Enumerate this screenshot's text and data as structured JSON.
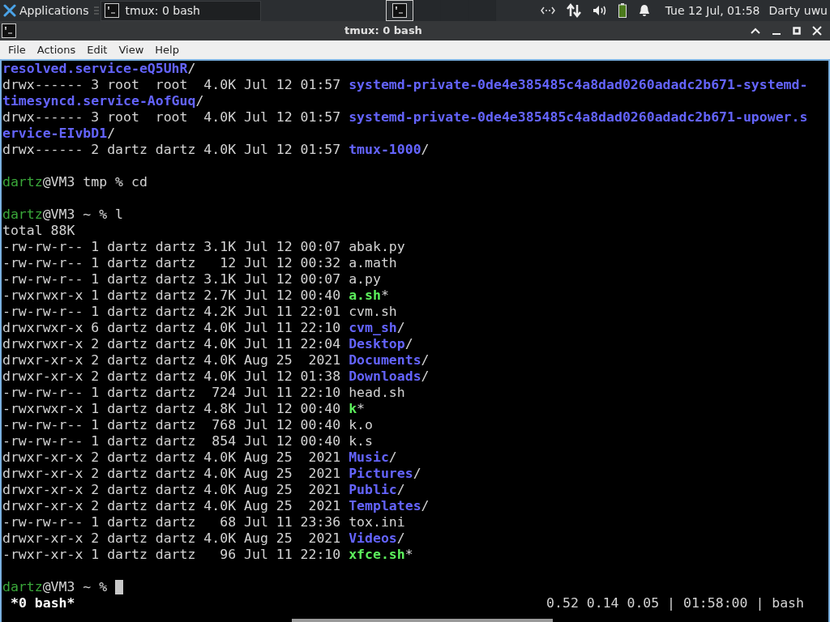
{
  "panel": {
    "applications": "Applications",
    "tasks": [
      {
        "label": "tmux: 0 bash",
        "selected": true
      }
    ],
    "workspaces": [
      {
        "selected": true
      },
      {
        "selected": false
      },
      {
        "selected": false
      },
      {
        "selected": false
      }
    ],
    "clock": "Tue 12 Jul, 01:58",
    "user": "Darty uwu"
  },
  "window": {
    "title": "tmux: 0 bash",
    "menu": [
      "File",
      "Actions",
      "Edit",
      "View",
      "Help"
    ]
  },
  "terminal": {
    "lines": [
      {
        "kind": "output",
        "segments": [
          {
            "kind": "dir",
            "text": "resolved.service-eQ5UhR"
          },
          {
            "kind": "plain",
            "text": "/"
          }
        ]
      },
      {
        "kind": "output",
        "segments": [
          {
            "kind": "plain",
            "text": "drwx------ 3 root  root  4.0K Jul 12 01:57 "
          },
          {
            "kind": "dir",
            "text": "systemd-private-0de4e385485c4a8dad0260adadc2b671-systemd-"
          }
        ]
      },
      {
        "kind": "output",
        "segments": [
          {
            "kind": "dir",
            "text": "timesyncd.service-AofGuq"
          },
          {
            "kind": "plain",
            "text": "/"
          }
        ]
      },
      {
        "kind": "output",
        "segments": [
          {
            "kind": "plain",
            "text": "drwx------ 3 root  root  4.0K Jul 12 01:57 "
          },
          {
            "kind": "dir",
            "text": "systemd-private-0de4e385485c4a8dad0260adadc2b671-upower.s"
          }
        ]
      },
      {
        "kind": "output",
        "segments": [
          {
            "kind": "dir",
            "text": "ervice-EIvbD1"
          },
          {
            "kind": "plain",
            "text": "/"
          }
        ]
      },
      {
        "kind": "output",
        "segments": [
          {
            "kind": "plain",
            "text": "drwx------ 2 dartz dartz 4.0K Jul 12 01:57 "
          },
          {
            "kind": "dir",
            "text": "tmux-1000"
          },
          {
            "kind": "plain",
            "text": "/"
          }
        ]
      },
      {
        "kind": "blank"
      },
      {
        "kind": "output",
        "segments": [
          {
            "kind": "user",
            "text": "dartz"
          },
          {
            "kind": "plain",
            "text": "@VM3 tmp % cd"
          }
        ]
      },
      {
        "kind": "blank"
      },
      {
        "kind": "output",
        "segments": [
          {
            "kind": "user",
            "text": "dartz"
          },
          {
            "kind": "plain",
            "text": "@VM3 ~ % l"
          }
        ]
      },
      {
        "kind": "output",
        "segments": [
          {
            "kind": "plain",
            "text": "total 88K"
          }
        ]
      },
      {
        "kind": "output",
        "segments": [
          {
            "kind": "plain",
            "text": "-rw-rw-r-- 1 dartz dartz 3.1K Jul 12 00:07 abak.py"
          }
        ]
      },
      {
        "kind": "output",
        "segments": [
          {
            "kind": "plain",
            "text": "-rw-rw-r-- 1 dartz dartz   12 Jul 12 00:32 a.math"
          }
        ]
      },
      {
        "kind": "output",
        "segments": [
          {
            "kind": "plain",
            "text": "-rw-rw-r-- 1 dartz dartz 3.1K Jul 12 00:07 a.py"
          }
        ]
      },
      {
        "kind": "output",
        "segments": [
          {
            "kind": "plain",
            "text": "-rwxrwxr-x 1 dartz dartz 2.7K Jul 12 00:40 "
          },
          {
            "kind": "exec",
            "text": "a.sh"
          },
          {
            "kind": "plain",
            "text": "*"
          }
        ]
      },
      {
        "kind": "output",
        "segments": [
          {
            "kind": "plain",
            "text": "-rw-rw-r-- 1 dartz dartz 4.2K Jul 11 22:01 cvm.sh"
          }
        ]
      },
      {
        "kind": "output",
        "segments": [
          {
            "kind": "plain",
            "text": "drwxrwxr-x 6 dartz dartz 4.0K Jul 11 22:10 "
          },
          {
            "kind": "dir",
            "text": "cvm_sh"
          },
          {
            "kind": "plain",
            "text": "/"
          }
        ]
      },
      {
        "kind": "output",
        "segments": [
          {
            "kind": "plain",
            "text": "drwxrwxr-x 2 dartz dartz 4.0K Jul 11 22:04 "
          },
          {
            "kind": "dir",
            "text": "Desktop"
          },
          {
            "kind": "plain",
            "text": "/"
          }
        ]
      },
      {
        "kind": "output",
        "segments": [
          {
            "kind": "plain",
            "text": "drwxr-xr-x 2 dartz dartz 4.0K Aug 25  2021 "
          },
          {
            "kind": "dir",
            "text": "Documents"
          },
          {
            "kind": "plain",
            "text": "/"
          }
        ]
      },
      {
        "kind": "output",
        "segments": [
          {
            "kind": "plain",
            "text": "drwxr-xr-x 2 dartz dartz 4.0K Jul 12 01:38 "
          },
          {
            "kind": "dir",
            "text": "Downloads"
          },
          {
            "kind": "plain",
            "text": "/"
          }
        ]
      },
      {
        "kind": "output",
        "segments": [
          {
            "kind": "plain",
            "text": "-rw-rw-r-- 1 dartz dartz  724 Jul 11 22:10 head.sh"
          }
        ]
      },
      {
        "kind": "output",
        "segments": [
          {
            "kind": "plain",
            "text": "-rwxrwxr-x 1 dartz dartz 4.8K Jul 12 00:40 "
          },
          {
            "kind": "exec",
            "text": "k"
          },
          {
            "kind": "plain",
            "text": "*"
          }
        ]
      },
      {
        "kind": "output",
        "segments": [
          {
            "kind": "plain",
            "text": "-rw-rw-r-- 1 dartz dartz  768 Jul 12 00:40 k.o"
          }
        ]
      },
      {
        "kind": "output",
        "segments": [
          {
            "kind": "plain",
            "text": "-rw-rw-r-- 1 dartz dartz  854 Jul 12 00:40 k.s"
          }
        ]
      },
      {
        "kind": "output",
        "segments": [
          {
            "kind": "plain",
            "text": "drwxr-xr-x 2 dartz dartz 4.0K Aug 25  2021 "
          },
          {
            "kind": "dir",
            "text": "Music"
          },
          {
            "kind": "plain",
            "text": "/"
          }
        ]
      },
      {
        "kind": "output",
        "segments": [
          {
            "kind": "plain",
            "text": "drwxr-xr-x 2 dartz dartz 4.0K Aug 25  2021 "
          },
          {
            "kind": "dir",
            "text": "Pictures"
          },
          {
            "kind": "plain",
            "text": "/"
          }
        ]
      },
      {
        "kind": "output",
        "segments": [
          {
            "kind": "plain",
            "text": "drwxr-xr-x 2 dartz dartz 4.0K Aug 25  2021 "
          },
          {
            "kind": "dir",
            "text": "Public"
          },
          {
            "kind": "plain",
            "text": "/"
          }
        ]
      },
      {
        "kind": "output",
        "segments": [
          {
            "kind": "plain",
            "text": "drwxr-xr-x 2 dartz dartz 4.0K Aug 25  2021 "
          },
          {
            "kind": "dir",
            "text": "Templates"
          },
          {
            "kind": "plain",
            "text": "/"
          }
        ]
      },
      {
        "kind": "output",
        "segments": [
          {
            "kind": "plain",
            "text": "-rw-rw-r-- 1 dartz dartz   68 Jul 11 23:36 tox.ini"
          }
        ]
      },
      {
        "kind": "output",
        "segments": [
          {
            "kind": "plain",
            "text": "drwxr-xr-x 2 dartz dartz 4.0K Aug 25  2021 "
          },
          {
            "kind": "dir",
            "text": "Videos"
          },
          {
            "kind": "plain",
            "text": "/"
          }
        ]
      },
      {
        "kind": "output",
        "segments": [
          {
            "kind": "plain",
            "text": "-rwxr-xr-x 1 dartz dartz   96 Jul 11 22:10 "
          },
          {
            "kind": "exec",
            "text": "xfce.sh"
          },
          {
            "kind": "plain",
            "text": "*"
          }
        ]
      },
      {
        "kind": "blank"
      },
      {
        "kind": "prompt",
        "segments": [
          {
            "kind": "user",
            "text": "dartz"
          },
          {
            "kind": "plain",
            "text": "@VM3 ~ % "
          }
        ]
      }
    ],
    "status_left": "*0 bash*",
    "status_right": "0.52 0.14 0.05 | 01:58:00 | bash"
  }
}
